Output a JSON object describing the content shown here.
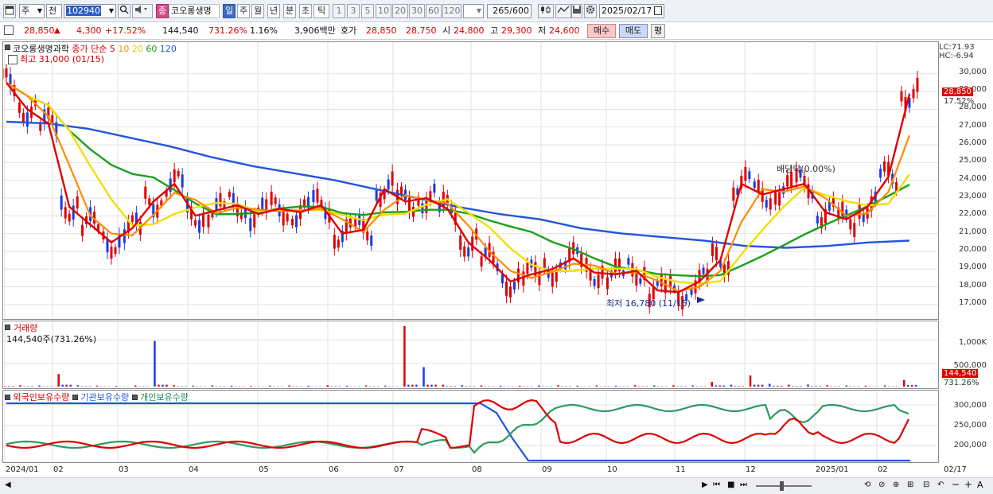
{
  "toolbar": {
    "type1": "주",
    "type2": "전",
    "code": "102940",
    "stock_tag": "종",
    "name": "코오롱생명",
    "periods": [
      "일",
      "주",
      "월",
      "년",
      "분",
      "초",
      "틱"
    ],
    "minutes": [
      "1",
      "3",
      "5",
      "10",
      "20",
      "30",
      "60",
      "120"
    ],
    "count": "265",
    "total": "/600",
    "date": "2025/02/17"
  },
  "quote": {
    "price": "28,850",
    "arrow": "▲",
    "change": "4,300",
    "pct": "+17.52%",
    "volume": "144,540",
    "vol_pct": "731.26%",
    "turnover": "1.16%",
    "amount": "3,906백만",
    "ask_label": "호가",
    "ask1": "28,850",
    "ask2": "28,750",
    "open_label": "시",
    "open": "24,800",
    "high_label": "고",
    "high": "29,300",
    "low_label": "저",
    "low": "24,600",
    "buy": "매수",
    "sell": "매도",
    "avg": "평"
  },
  "price_pane": {
    "legend_name": "코오롱생명과학",
    "legend_ma": "종가 단순",
    "ma_periods": [
      "5",
      "10",
      "20",
      "60",
      "120"
    ],
    "ma_colors": [
      "#e60000",
      "#ff8c00",
      "#f0e000",
      "#1aa01a",
      "#2255dd"
    ],
    "high_note": "최고 31,000 (01/15)",
    "low_note": "최저 16,780 (11/15)",
    "div_note": "배당락(0.00%)",
    "lc": "LC:71.93",
    "hc": "HC:-6.94",
    "cur_price": "28,850",
    "cur_pct": "17.52%",
    "y_ticks": [
      "30,000",
      "29,000",
      "28,000",
      "27,000",
      "26,000",
      "25,000",
      "24,000",
      "23,000",
      "22,000",
      "21,000",
      "20,000",
      "19,000",
      "18,000",
      "17,000"
    ]
  },
  "volume_pane": {
    "title": "거래량",
    "value": "144,540주(731.26%)",
    "y_ticks": [
      "1,000K",
      "500,000"
    ],
    "cur": "144,540",
    "cur_pct": "731.26%"
  },
  "holding_pane": {
    "legends": [
      "외국인보유수량",
      "기관보유수량",
      "개인보유수량"
    ],
    "colors": [
      "#d40000",
      "#2255dd",
      "#1a8a50"
    ],
    "y_ticks": [
      "300,000",
      "250,000",
      "200,000"
    ]
  },
  "x_axis": {
    "labels": [
      "2024/01",
      "02",
      "03",
      "04",
      "05",
      "06",
      "07",
      "08",
      "09",
      "10",
      "11",
      "12",
      "2025/01",
      "02"
    ],
    "right_date": "02/17"
  },
  "chart_data": [
    {
      "type": "line",
      "title": "코오롱생명과학",
      "x_start": "2024/01",
      "x_end": "2025/02/17",
      "y_range": [
        16500,
        31000
      ],
      "series": [
        {
          "name": "5",
          "values": [
            29500,
            28000,
            27200,
            22500,
            21500,
            20500,
            21300,
            22800,
            23800,
            22000,
            22300,
            22600,
            22100,
            22400,
            22200,
            22600,
            21000,
            21200,
            23500,
            22800,
            23000,
            22400,
            20500,
            19500,
            18300,
            18700,
            19000,
            19600,
            18800,
            18700,
            18900,
            17800,
            17700,
            18300,
            19500,
            23800,
            23200,
            23500,
            23800,
            22200,
            21800,
            22500,
            24200,
            28850
          ]
        },
        {
          "name": "120",
          "values": [
            27300,
            27200,
            26900,
            26400,
            25900,
            25300,
            24800,
            24400,
            24000,
            23500,
            23000,
            22500,
            22100,
            21800,
            21300,
            21000,
            20800,
            20600,
            20300,
            20200,
            20300,
            20500,
            20600
          ]
        }
      ]
    },
    {
      "type": "bar",
      "title": "거래량",
      "y_range": [
        0,
        1300000
      ],
      "values": [
        40000,
        30000,
        25000,
        270000,
        30000,
        20000,
        15000,
        25000,
        980000,
        30000,
        20000,
        25000,
        20000,
        15000,
        20000,
        25000,
        20000,
        30000,
        20000,
        25000,
        20000,
        1300000,
        420000,
        40000,
        30000,
        25000,
        20000,
        20000,
        25000,
        30000,
        20000,
        25000,
        20000,
        30000,
        25000,
        30000,
        25000,
        100000,
        40000,
        240000,
        60000,
        40000,
        45000,
        30000,
        25000,
        20000,
        25000,
        144540
      ]
    }
  ]
}
